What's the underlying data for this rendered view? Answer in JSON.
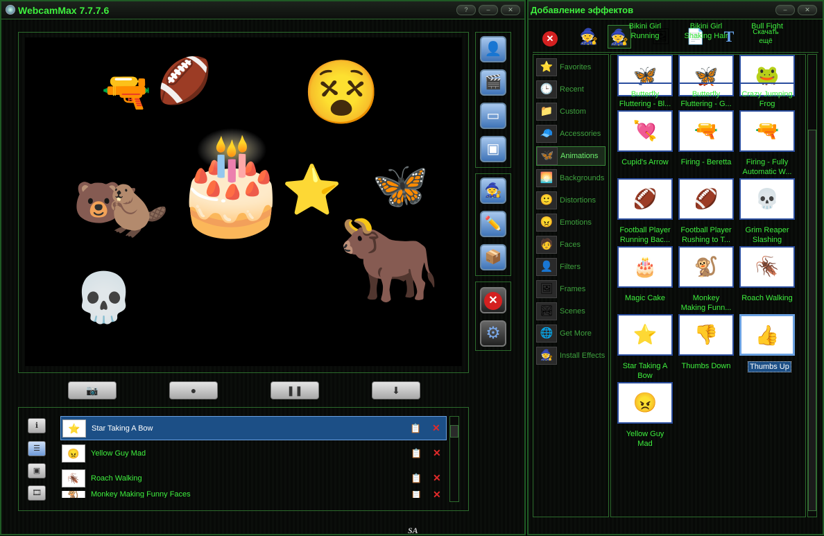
{
  "main_window": {
    "title": "WebcamMax  7.7.7.6",
    "footer": "SA",
    "controls": {
      "snapshot": "📷",
      "record": "●",
      "pause": "❚❚",
      "download": "⬇"
    },
    "list_tabs": [
      "ℹ",
      "☰",
      "▣",
      "🎞"
    ]
  },
  "preview_stickers": [
    {
      "name": "gun-sticker",
      "glyph": "🔫"
    },
    {
      "name": "football-player-sticker",
      "glyph": "🏈"
    },
    {
      "name": "yellow-guy-sticker",
      "glyph": "😵"
    },
    {
      "name": "bear-sticker",
      "glyph": "🐻"
    },
    {
      "name": "beaver-sticker",
      "glyph": "🦫"
    },
    {
      "name": "cake-sticker",
      "glyph": "🎂"
    },
    {
      "name": "star-sticker",
      "glyph": "⭐"
    },
    {
      "name": "butterfly-sticker",
      "glyph": "🦋"
    },
    {
      "name": "reaper-sticker",
      "glyph": "💀"
    },
    {
      "name": "bull-sticker",
      "glyph": "🐂"
    }
  ],
  "active_effects": [
    {
      "label": "Star Taking A Bow",
      "icon": "⭐",
      "selected": true
    },
    {
      "label": "Yellow Guy Mad",
      "icon": "😠",
      "selected": false
    },
    {
      "label": "Roach Walking",
      "icon": "🪳",
      "selected": false
    },
    {
      "label": "Monkey Making Funny Faces",
      "icon": "🐒",
      "selected": false
    }
  ],
  "effects_window": {
    "title": "Добавление эффектов",
    "download_more": "Скачать\nещё",
    "categories": [
      {
        "label": "Favorites",
        "icon": "⭐"
      },
      {
        "label": "Recent",
        "icon": "🕒"
      },
      {
        "label": "Custom",
        "icon": "📁"
      },
      {
        "label": "Accessories",
        "icon": "🧢"
      },
      {
        "label": "Animations",
        "icon": "🦋",
        "selected": true
      },
      {
        "label": "Backgrounds",
        "icon": "🌅"
      },
      {
        "label": "Distortions",
        "icon": "🙂"
      },
      {
        "label": "Emotions",
        "icon": "😠"
      },
      {
        "label": "Faces",
        "icon": "🧑"
      },
      {
        "label": "Filters",
        "icon": "👤"
      },
      {
        "label": "Frames",
        "icon": "🖼"
      },
      {
        "label": "Scenes",
        "icon": "🏞"
      },
      {
        "label": "Get More",
        "icon": "🌐"
      },
      {
        "label": "Install Effects",
        "icon": "🧙"
      }
    ],
    "effects": [
      {
        "label": "Bikini Girl\nRunning",
        "icon": "🏃‍♀️"
      },
      {
        "label": "Bikini Girl\nShaking Hair",
        "icon": "💃"
      },
      {
        "label": "Bull Fight",
        "icon": "🐂"
      },
      {
        "label": "Butterfly\nFluttering - Bl...",
        "icon": "🦋"
      },
      {
        "label": "Butterfly\nFluttering - G...",
        "icon": "🦋"
      },
      {
        "label": "Crazy Jumping\nFrog",
        "icon": "🐸"
      },
      {
        "label": "Cupid's Arrow",
        "icon": "💘"
      },
      {
        "label": "Firing - Beretta",
        "icon": "🔫"
      },
      {
        "label": "Firing - Fully\nAutomatic W...",
        "icon": "🔫"
      },
      {
        "label": "Football Player\nRunning Bac...",
        "icon": "🏈"
      },
      {
        "label": "Football Player\nRushing to T...",
        "icon": "🏈"
      },
      {
        "label": "Grim Reaper\nSlashing",
        "icon": "💀"
      },
      {
        "label": "Magic Cake",
        "icon": "🎂"
      },
      {
        "label": "Monkey\nMaking Funn...",
        "icon": "🐒"
      },
      {
        "label": "Roach Walking",
        "icon": "🪳"
      },
      {
        "label": "Star Taking A\nBow",
        "icon": "⭐"
      },
      {
        "label": "Thumbs Down",
        "icon": "👎"
      },
      {
        "label": "Thumbs Up",
        "icon": "👍"
      },
      {
        "label": "Yellow Guy\nMad",
        "icon": "😠"
      }
    ]
  }
}
